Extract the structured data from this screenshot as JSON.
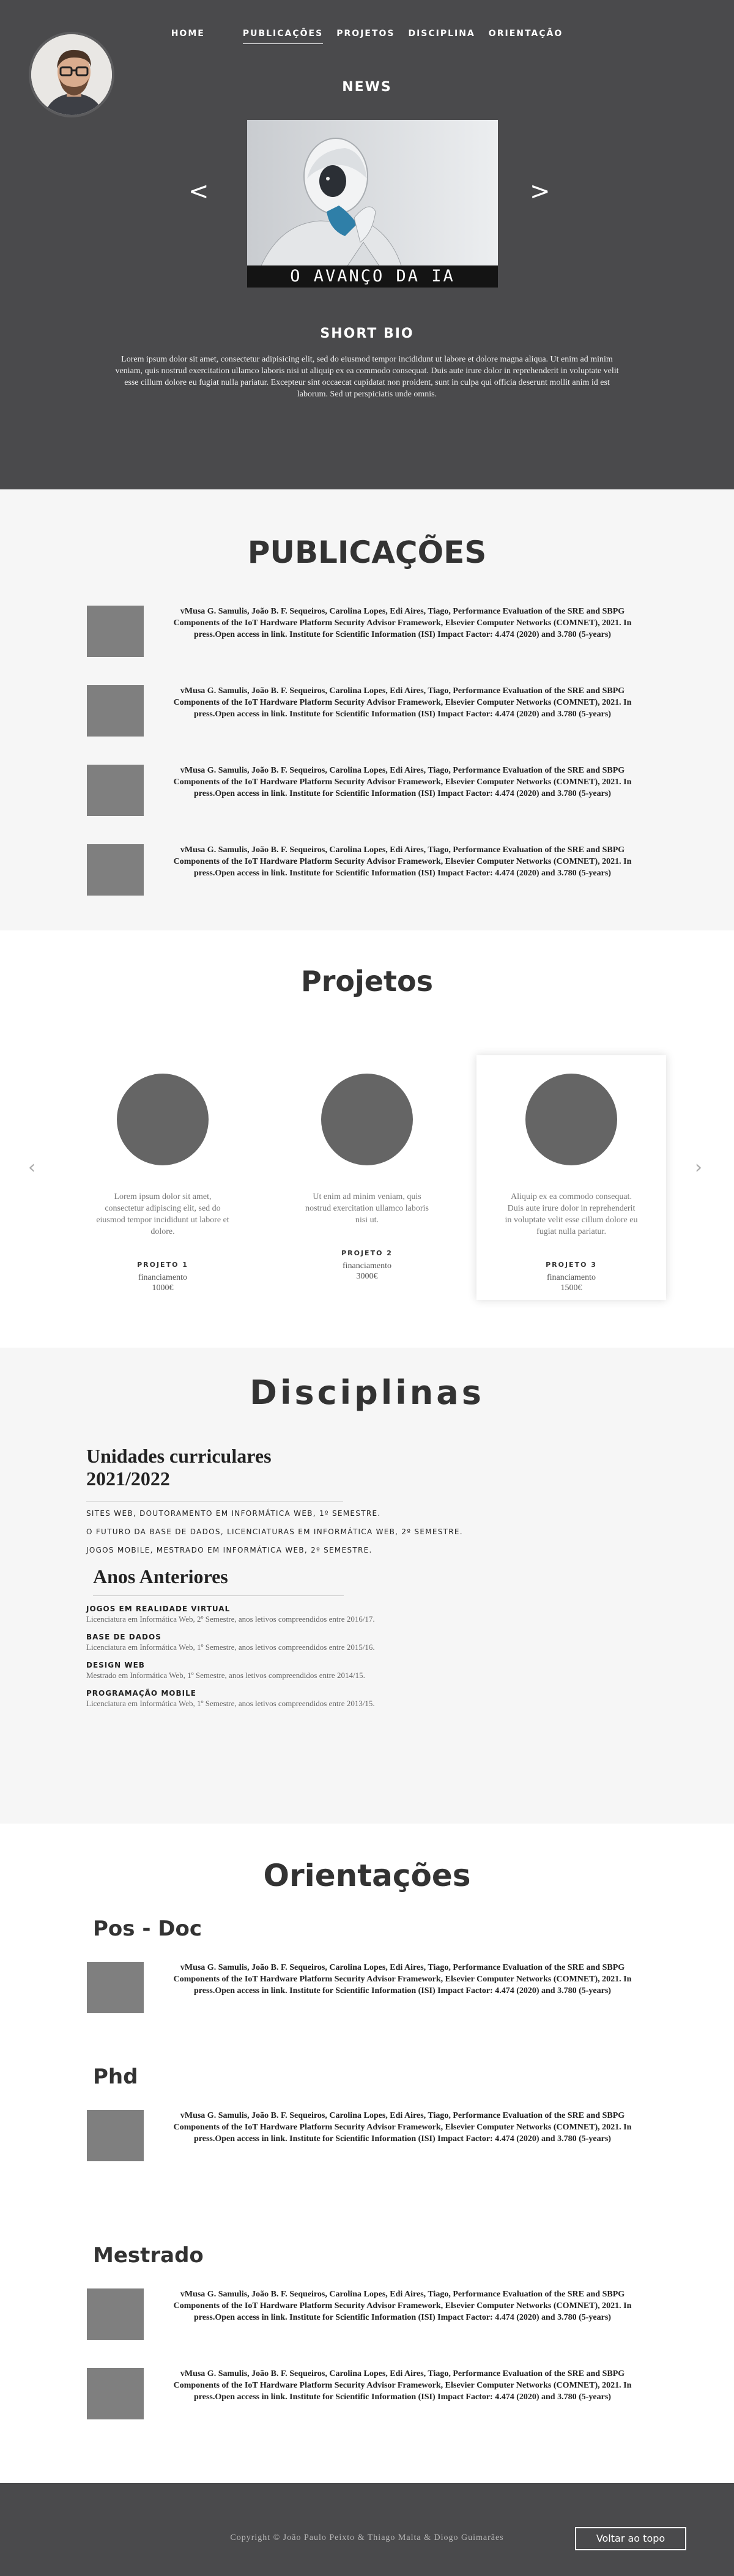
{
  "nav": {
    "items": [
      "HOME",
      "PUBLICAÇÕES",
      "PROJETOS",
      "DISCIPLINA",
      "ORIENTAÇÃO"
    ]
  },
  "hero": {
    "news_title": "NEWS",
    "slide_caption": "O AVANÇO DA IA",
    "prev_arrow": "<",
    "next_arrow": ">",
    "bio_title": "SHORT BIO",
    "bio_text": "Lorem ipsum dolor sit amet, consectetur adipisicing elit, sed do eiusmod tempor incididunt ut labore et dolore magna aliqua. Ut enim ad minim veniam, quis nostrud exercitation ullamco laboris nisi ut aliquip ex ea commodo consequat. Duis aute irure dolor in reprehenderit in voluptate velit esse cillum dolore eu fugiat nulla pariatur. Excepteur sint occaecat cupidatat non proident, sunt in culpa qui officia deserunt mollit anim id est laborum. Sed ut perspiciatis unde omnis."
  },
  "publications": {
    "title": "PUBLICAÇÕES",
    "items": [
      "vMusa G. Samulis, João B. F. Sequeiros, Carolina Lopes, Edi Aires, Tiago, Performance Evaluation of the SRE and SBPG Components of the IoT Hardware Platform Security Advisor Framework, Elsevier Computer Networks (COMNET), 2021. In press.Open access in link. Institute for Scientific Information (ISI) Impact Factor: 4.474 (2020) and 3.780 (5-years)",
      "vMusa G. Samulis, João B. F. Sequeiros, Carolina Lopes, Edi Aires, Tiago, Performance Evaluation of the SRE and SBPG Components of the IoT Hardware Platform Security Advisor Framework, Elsevier Computer Networks (COMNET), 2021. In press.Open access in link. Institute for Scientific Information (ISI) Impact Factor: 4.474 (2020) and 3.780 (5-years)",
      "vMusa G. Samulis, João B. F. Sequeiros, Carolina Lopes, Edi Aires, Tiago, Performance Evaluation of the SRE and SBPG Components of the IoT Hardware Platform Security Advisor Framework, Elsevier Computer Networks (COMNET), 2021. In press.Open access in link. Institute for Scientific Information (ISI) Impact Factor: 4.474 (2020) and 3.780 (5-years)",
      "vMusa G. Samulis, João B. F. Sequeiros, Carolina Lopes, Edi Aires, Tiago, Performance Evaluation of the SRE and SBPG Components of the IoT Hardware Platform Security Advisor Framework, Elsevier Computer Networks (COMNET), 2021. In press.Open access in link. Institute for Scientific Information (ISI) Impact Factor: 4.474 (2020) and 3.780 (5-years)"
    ]
  },
  "projects": {
    "title": "Projetos",
    "prev_arrow": "‹",
    "next_arrow": "›",
    "cards": [
      {
        "desc": "Lorem ipsum dolor sit amet, consectetur adipiscing elit, sed do eiusmod tempor incididunt ut labore et dolore.",
        "name": "PROJETO 1",
        "fin_label": "financiamento",
        "amount": "1000€"
      },
      {
        "desc": "Ut enim ad minim veniam, quis nostrud exercitation ullamco laboris nisi ut.",
        "name": "PROJETO 2",
        "fin_label": "financiamento",
        "amount": "3000€"
      },
      {
        "desc": "Aliquip ex ea commodo consequat. Duis aute irure dolor in reprehenderit in voluptate velit esse cillum dolore eu fugiat nulla pariatur.",
        "name": "PROJETO 3",
        "fin_label": "financiamento",
        "amount": "1500€"
      }
    ]
  },
  "disciplines": {
    "title": "Disciplinas",
    "uc_title": "Unidades curriculares 2021/2022",
    "uc_items": [
      "SITES WEB, DOUTORAMENTO EM INFORMÁTICA WEB, 1º SEMESTRE.",
      "O FUTURO DA BASE DE DADOS, LICENCIATURAS EM INFORMÁTICA WEB, 2º SEMESTRE.",
      "JOGOS MOBILE, MESTRADO EM INFORMÁTICA WEB, 2º SEMESTRE."
    ],
    "past_title": "Anos Anteriores",
    "past_items": [
      {
        "name": "JOGOS EM REALIDADE VIRTUAL",
        "detail": "Licenciatura em Informática Web, 2º Semestre, anos letivos compreendidos entre 2016/17."
      },
      {
        "name": "BASE DE DADOS",
        "detail": "Licenciatura em Informática Web, 1º Semestre, anos letivos compreendidos entre 2015/16."
      },
      {
        "name": "DESIGN WEB",
        "detail": "Mestrado em Informática Web, 1º Semestre, anos letivos compreendidos entre 2014/15."
      },
      {
        "name": "PROGRAMAÇÃO MOBILE",
        "detail": "Licenciatura em Informática Web, 1º Semestre, anos letivos compreendidos entre 2013/15."
      }
    ]
  },
  "orientations": {
    "title": "Orientações",
    "postdoc_title": "Pos - Doc",
    "phd_title": "Phd",
    "masters_title": "Mestrado",
    "entry": "vMusa G. Samulis, João B. F. Sequeiros, Carolina Lopes, Edi Aires, Tiago, Performance Evaluation of the SRE and SBPG Components of the IoT Hardware Platform Security Advisor Framework, Elsevier Computer Networks (COMNET), 2021. In press.Open access in link. Institute for Scientific Information (ISI) Impact Factor: 4.474 (2020) and 3.780 (5-years)"
  },
  "footer": {
    "copyright": "Copyright ©  João Paulo Peixto & Thiago Malta & Diogo Guimarães",
    "top_button": "Voltar ao topo"
  }
}
